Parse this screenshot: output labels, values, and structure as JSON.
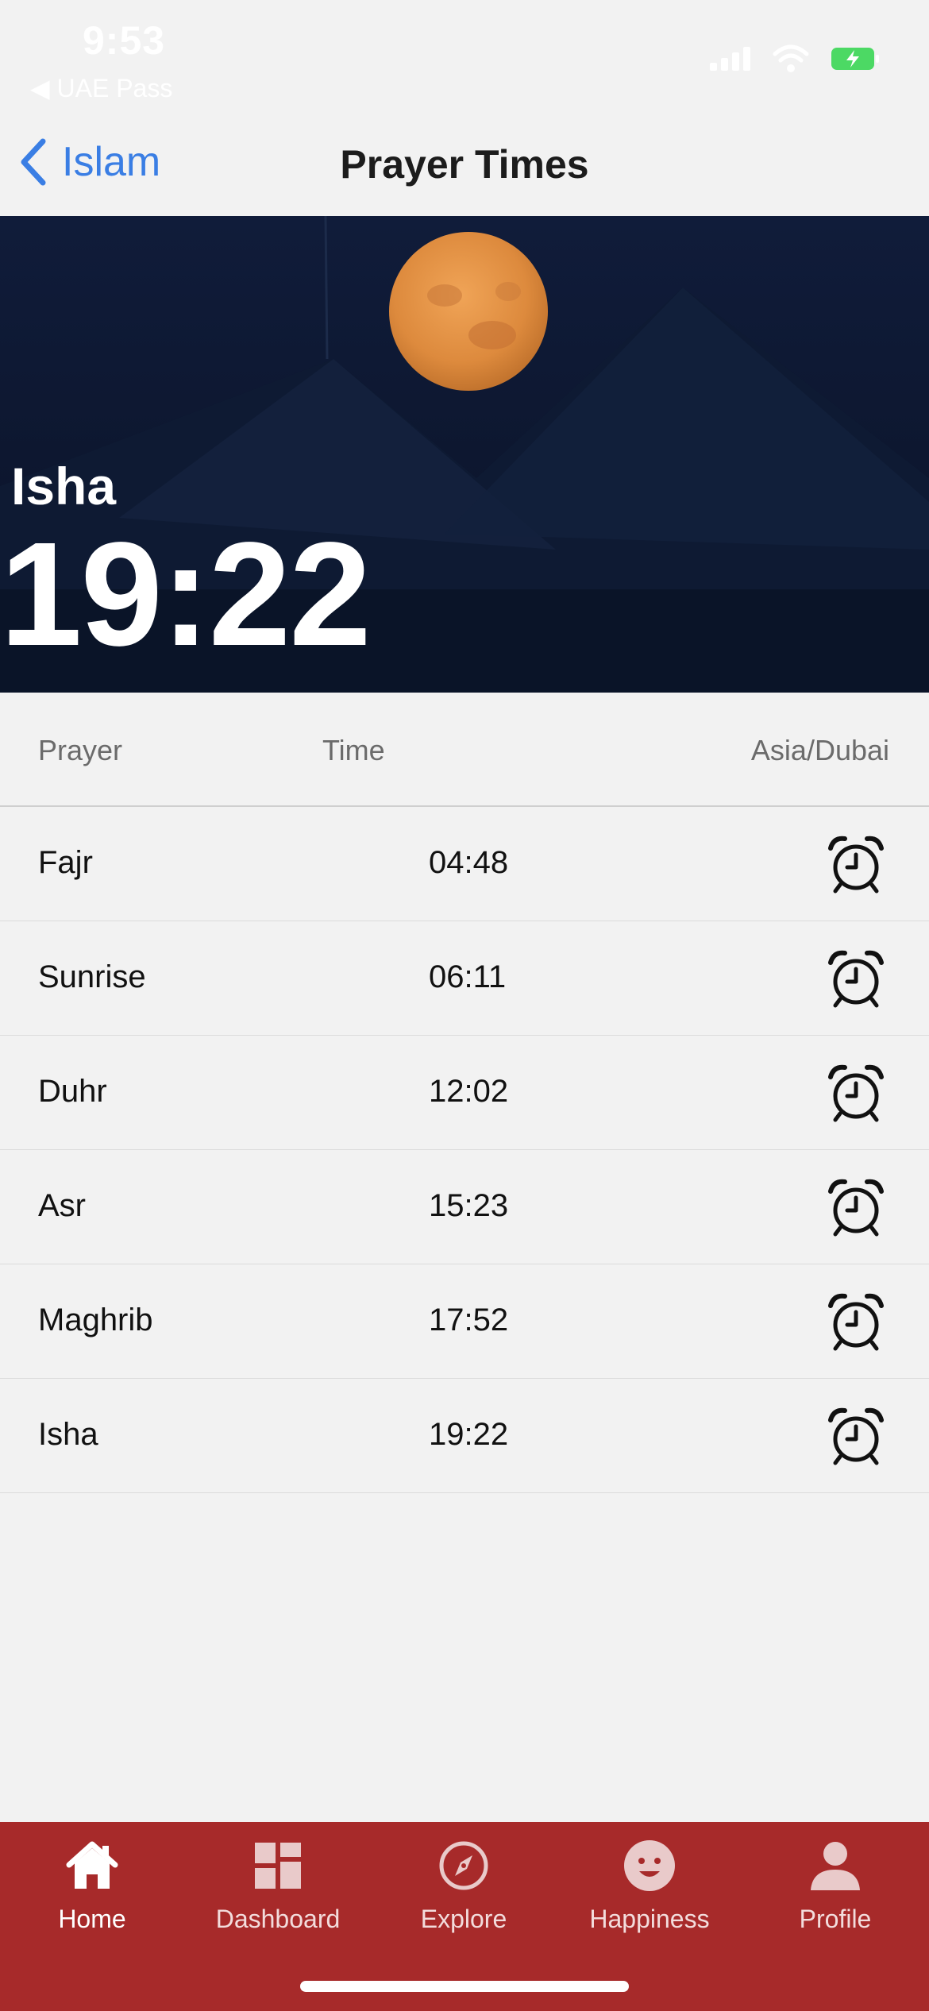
{
  "status_bar": {
    "time": "9:53",
    "back_app": "◀ UAE Pass"
  },
  "nav": {
    "back_label": "Islam",
    "title": "Prayer Times"
  },
  "hero": {
    "prayer": "Isha",
    "time": "19:22"
  },
  "table": {
    "headers": {
      "prayer": "Prayer",
      "time": "Time",
      "timezone": "Asia/Dubai"
    },
    "rows": [
      {
        "name": "Fajr",
        "time": "04:48"
      },
      {
        "name": "Sunrise",
        "time": "06:11"
      },
      {
        "name": "Duhr",
        "time": "12:02"
      },
      {
        "name": "Asr",
        "time": "15:23"
      },
      {
        "name": "Maghrib",
        "time": "17:52"
      },
      {
        "name": "Isha",
        "time": "19:22"
      }
    ]
  },
  "tabs": [
    {
      "label": "Home",
      "icon": "home-icon",
      "active": true
    },
    {
      "label": "Dashboard",
      "icon": "dashboard-icon",
      "active": false
    },
    {
      "label": "Explore",
      "icon": "compass-icon",
      "active": false
    },
    {
      "label": "Happiness",
      "icon": "smiley-icon",
      "active": false
    },
    {
      "label": "Profile",
      "icon": "person-icon",
      "active": false
    }
  ],
  "colors": {
    "accent": "#3a7ee4",
    "tab_bar": "#a72a2a",
    "hero_bg": "#0c1730",
    "battery": "#4cd964"
  }
}
